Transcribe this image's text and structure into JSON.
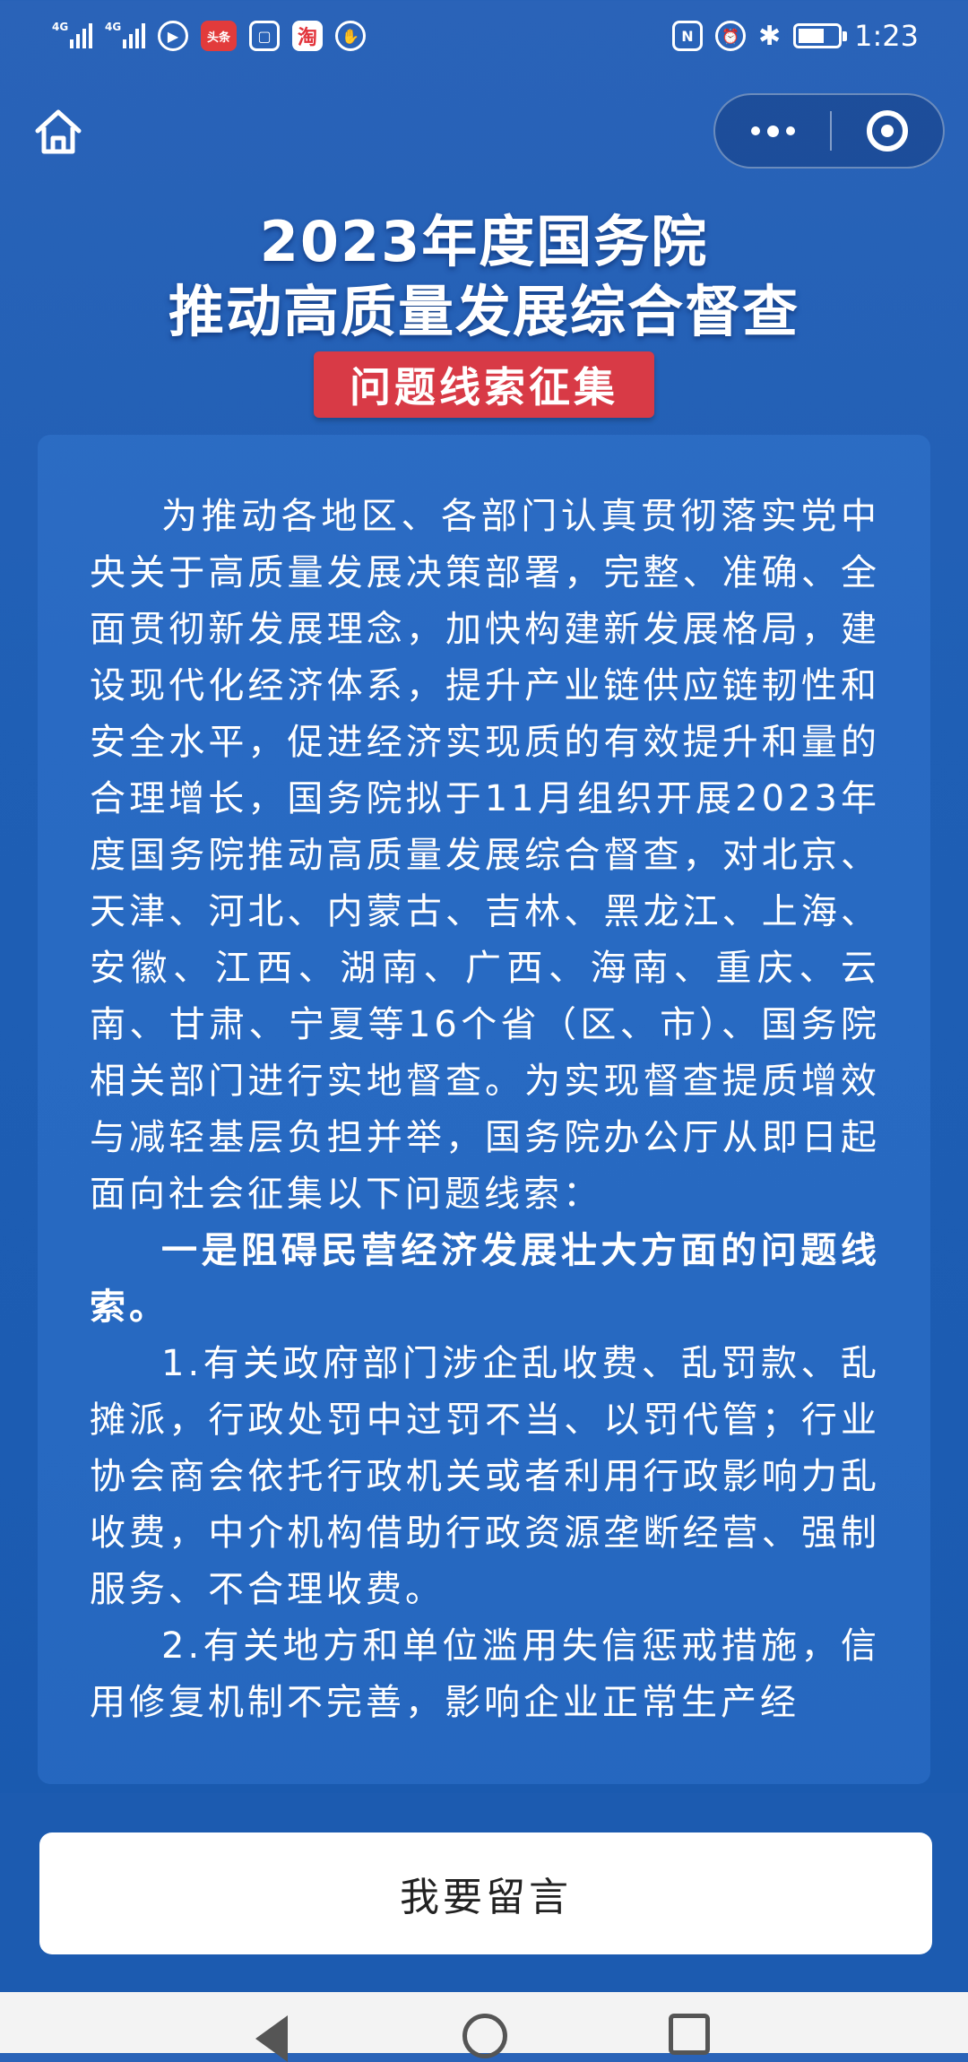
{
  "status_bar": {
    "network1": "4G",
    "network2": "4G",
    "app_icon_toutiao": "头条",
    "app_icon_taobao": "淘",
    "time": "1:23"
  },
  "header": {
    "title_line1": "2023年度国务院",
    "title_line2": "推动高质量发展综合督查",
    "badge": "问题线索征集"
  },
  "article": {
    "paragraphs": [
      "为推动各地区、各部门认真贯彻落实党中央关于高质量发展决策部署，完整、准确、全面贯彻新发展理念，加快构建新发展格局，建设现代化经济体系，提升产业链供应链韧性和安全水平，促进经济实现质的有效提升和量的合理增长，国务院拟于11月组织开展2023年度国务院推动高质量发展综合督查，对北京、天津、河北、内蒙古、吉林、黑龙江、上海、安徽、江西、湖南、广西、海南、重庆、云南、甘肃、宁夏等16个省（区、市）、国务院相关部门进行实地督查。为实现督查提质增效与减轻基层负担并举，国务院办公厅从即日起面向社会征集以下问题线索：",
      "一是阻碍民营经济发展壮大方面的问题线索。",
      "1.有关政府部门涉企乱收费、乱罚款、乱摊派，行政处罚中过罚不当、以罚代管；行业协会商会依托行政机关或者利用行政影响力乱收费，中介机构借助行政资源垄断经营、强制服务、不合理收费。",
      "2.有关地方和单位滥用失信惩戒措施，信用修复机制不完善，影响企业正常生产经"
    ]
  },
  "footer": {
    "reply_button": "我要留言"
  },
  "colors": {
    "background": "#1f5fb5",
    "badge": "#d83a46",
    "button": "#ffffff"
  }
}
